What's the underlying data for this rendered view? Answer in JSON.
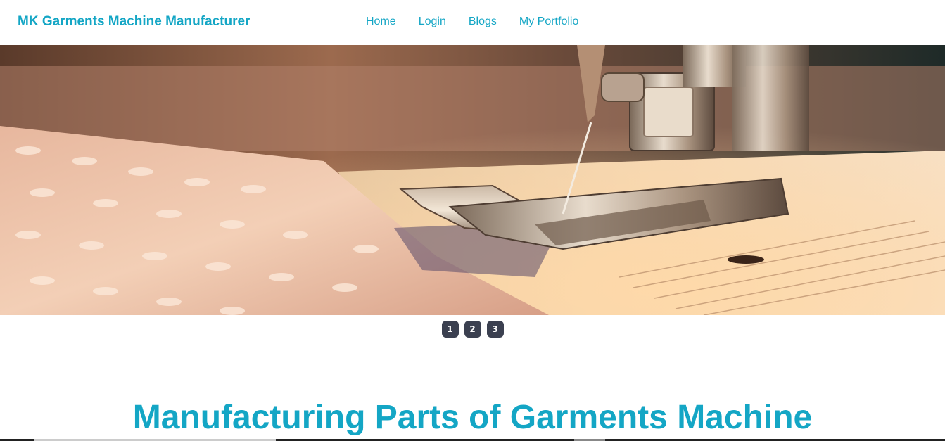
{
  "brand": {
    "title": "MK Garments Machine Manufacturer"
  },
  "nav": {
    "items": [
      {
        "label": "Home"
      },
      {
        "label": "Login"
      },
      {
        "label": "Blogs"
      },
      {
        "label": "My Portfolio"
      }
    ]
  },
  "hero": {
    "image": "sewing-machine-presser-foot-photo"
  },
  "carousel": {
    "indicators": [
      "1",
      "2",
      "3"
    ],
    "active": "1"
  },
  "section": {
    "title": "Manufacturing Parts of Garments Machine"
  },
  "colors": {
    "accent": "#14a6c5",
    "indicator_bg": "#3b4050"
  }
}
